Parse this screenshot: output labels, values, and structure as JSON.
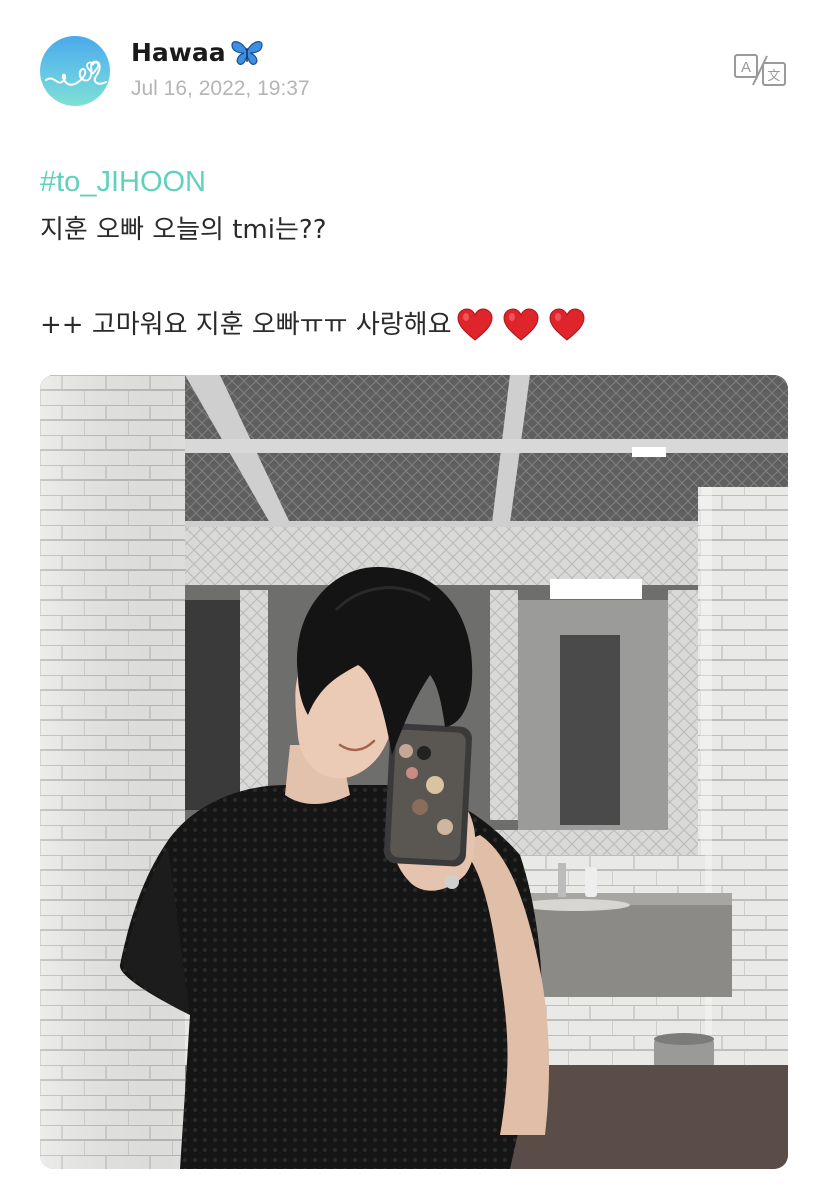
{
  "post": {
    "author_name": "Hawaa",
    "author_emoji": "butterfly",
    "timestamp": "Jul 16, 2022, 19:37",
    "hashtag": "#to_JIHOON",
    "line1": "지훈 오빠 오늘의 tmi는??",
    "line2": "++ 고마워요 지훈 오빠ㅠㅠ 사랑해요",
    "hearts_count": 3
  },
  "icons": {
    "avatar": "avatar-heart-line-icon",
    "translate": "translate-icon",
    "butterfly": "butterfly-icon",
    "heart": "red-heart-icon"
  },
  "colors": {
    "hashtag": "#5fd2bd",
    "timestamp": "#b5b5b5",
    "butterfly": "#3d8fe0",
    "heart": "#e0242b"
  }
}
